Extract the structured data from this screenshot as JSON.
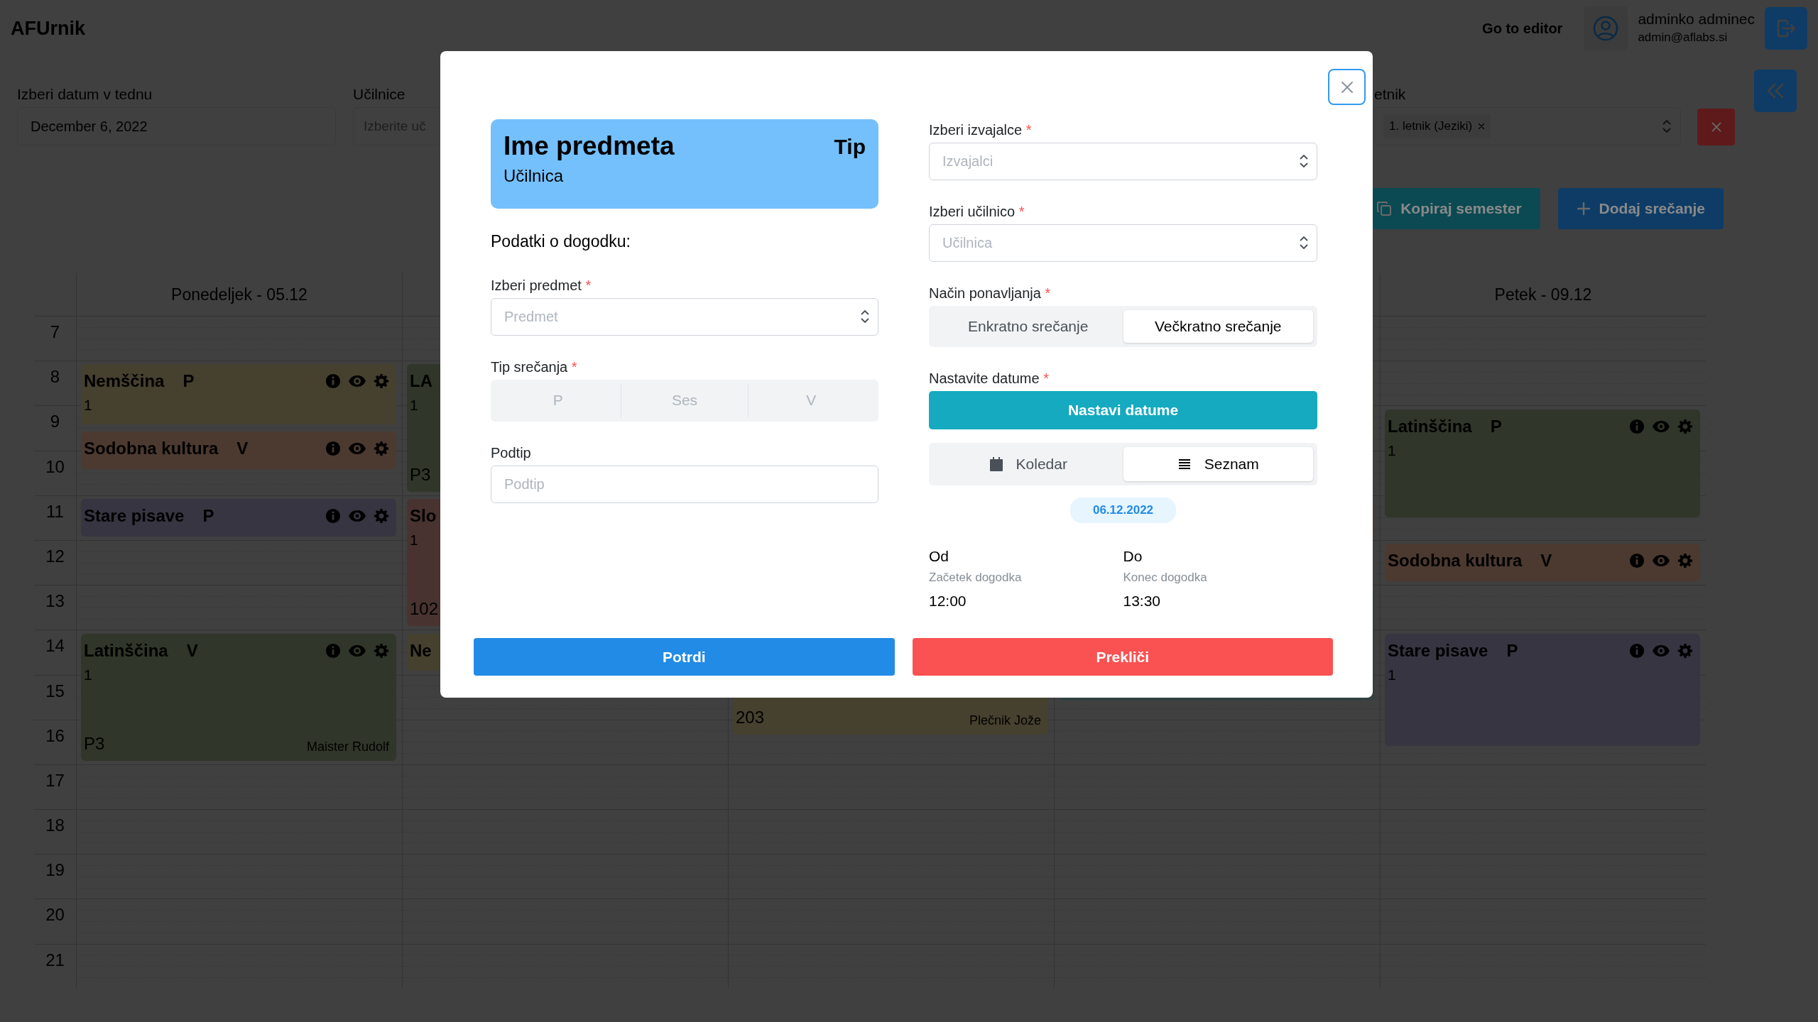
{
  "header": {
    "logo": "AFUrnik",
    "editor_link": "Go to editor",
    "user_name": "adminko adminec",
    "user_email": "admin@aflabs.si"
  },
  "filters": [
    {
      "kind": "date",
      "label": "Izberi datum v tednu",
      "value": "December 6, 2022"
    },
    {
      "kind": "select",
      "label": "Učilnice",
      "placeholder": "Izberite uč"
    },
    {
      "kind": "multiselect",
      "label": "etnik",
      "tags": [
        "1. letnik (Jeziki)"
      ]
    }
  ],
  "toolbar": [
    {
      "kind": "copy",
      "label": "Kopiraj semester"
    },
    {
      "kind": "add",
      "label": "Dodaj srečanje"
    }
  ],
  "calendar": {
    "hours": [
      "7",
      "8",
      "9",
      "10",
      "11",
      "12",
      "13",
      "14",
      "15",
      "16",
      "17",
      "18",
      "19",
      "20",
      "21"
    ],
    "days": [
      {
        "title": "Ponedeljek - 05.12",
        "events": [
          {
            "name": "Nemščina",
            "type": "P",
            "group": "1",
            "color": "#46402f",
            "actions": true
          },
          {
            "name": "Sodobna kultura",
            "type": "V",
            "color": "#4c3a31",
            "actions": true
          },
          {
            "name": "Stare pisave",
            "type": "P",
            "color": "#373541",
            "actions": true
          },
          {
            "name": "Latinščina",
            "type": "V",
            "group": "1",
            "room": "P3",
            "teacher": "Maister Rudolf",
            "color": "#303629",
            "actions": true
          }
        ]
      },
      {
        "events": [
          {
            "name": "LA",
            "group": "1",
            "room": "P3",
            "color": "#303629"
          },
          {
            "name": "Slo",
            "group": "1",
            "room": "102",
            "color": "#483330"
          },
          {
            "name": "Ne",
            "color": "#46402f"
          }
        ]
      },
      {
        "events": [
          {
            "room": "203",
            "teacher": "Plečnik Jože",
            "color": "#46402f"
          }
        ]
      },
      {
        "events": [
          {
            "color": "#46402f"
          },
          {
            "color": "#4c3a31"
          },
          {
            "color": "#324141"
          }
        ]
      },
      {
        "title": "Petek - 09.12",
        "events": [
          {
            "name": "Latinščina",
            "type": "P",
            "group": "1",
            "color": "#303629",
            "actions": true
          },
          {
            "name": "Sodobna kultura",
            "type": "V",
            "color": "#4c3a31",
            "actions": true
          },
          {
            "name": "Stare pisave",
            "type": "P",
            "group": "1",
            "color": "#373541",
            "actions": true
          }
        ]
      }
    ]
  },
  "modal": {
    "preview": {
      "title": "Ime predmeta",
      "type": "Tip",
      "room": "Učilnica"
    },
    "section_title": "Podatki o dogodku:",
    "left_fields": [
      {
        "kind": "select",
        "label": "Izberi predmet",
        "asterisk": "*",
        "placeholder": "Predmet"
      },
      {
        "kind": "segmented",
        "label": "Tip srečanja",
        "asterisk": "*",
        "disabled": true,
        "options": [
          {
            "label": "P",
            "selected": false
          },
          {
            "label": "Ses",
            "selected": false
          },
          {
            "label": "V",
            "selected": false
          }
        ]
      },
      {
        "kind": "input",
        "label": "Podtip",
        "placeholder": "Podtip"
      }
    ],
    "right_fields": [
      {
        "kind": "select",
        "label": "Izberi izvajalce",
        "asterisk": "*",
        "placeholder": "Izvajalci"
      },
      {
        "kind": "select",
        "label": "Izberi učilnico",
        "asterisk": "*",
        "placeholder": "Učilnica"
      },
      {
        "kind": "segmented",
        "label": "Način ponavljanja",
        "asterisk": "*",
        "options": [
          {
            "label": "Enkratno srečanje",
            "selected": false
          },
          {
            "label": "Večkratno srečanje",
            "selected": true
          }
        ]
      },
      {
        "kind": "button",
        "label": "Nastavite datume",
        "asterisk": "*",
        "button": "Nastavi datume"
      },
      {
        "kind": "view-toggle",
        "options": [
          {
            "label": "Koledar",
            "selected": false
          },
          {
            "label": "Seznam",
            "selected": true
          }
        ]
      },
      {
        "kind": "badge",
        "text": "06.12.2022"
      },
      {
        "kind": "times",
        "items": [
          {
            "label": "Od",
            "hint": "Začetek dogodka",
            "value": "12:00"
          },
          {
            "label": "Do",
            "hint": "Konec dogodka",
            "value": "13:30"
          }
        ]
      }
    ],
    "buttons": [
      {
        "kind": "confirm",
        "label": "Potrdi"
      },
      {
        "kind": "cancel",
        "label": "Prekliči"
      }
    ]
  }
}
